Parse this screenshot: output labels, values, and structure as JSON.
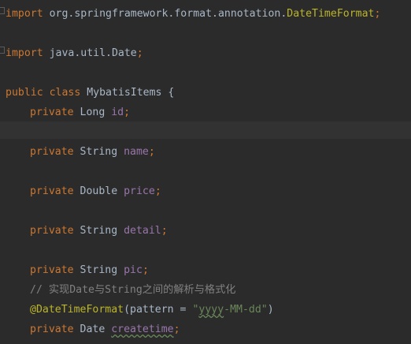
{
  "code": {
    "l1": {
      "kw": "import",
      "path": " org.springframework.format.annotation.",
      "cls": "DateTimeFormat",
      "semi": ";"
    },
    "l2": {
      "kw": "import",
      "path": " java.util.Date",
      "semi": ";"
    },
    "l3": {
      "kw": "public class",
      "name": " MybatisItems {"
    },
    "l4": {
      "kw": "private",
      "type": " Long ",
      "field": "id",
      "semi": ";"
    },
    "l5": {
      "kw": "private",
      "type": " String ",
      "field": "name",
      "semi": ";"
    },
    "l6": {
      "kw": "private",
      "type": " Double ",
      "field": "price",
      "semi": ";"
    },
    "l7": {
      "kw": "private",
      "type": " String ",
      "field": "detail",
      "semi": ";"
    },
    "l8": {
      "kw": "private",
      "type": " String ",
      "field": "pic",
      "semi": ";"
    },
    "l9": {
      "comment": "// 实现Date与String之间的解析与格式化"
    },
    "l10": {
      "ann": "@DateTimeFormat",
      "open": "(pattern = ",
      "str_open": "\"",
      "str_val": "yyyy",
      "str_rest": "-MM-dd\"",
      "close": ")"
    },
    "l11": {
      "kw": "private",
      "type": " Date ",
      "field": "createtime",
      "semi": ";"
    }
  },
  "colors": {
    "background": "#2b2b2b",
    "keyword": "#cc7832",
    "field": "#9876aa",
    "annotation": "#bbb529",
    "comment": "#808080",
    "string": "#6a8759",
    "text": "#a9b7c6"
  }
}
